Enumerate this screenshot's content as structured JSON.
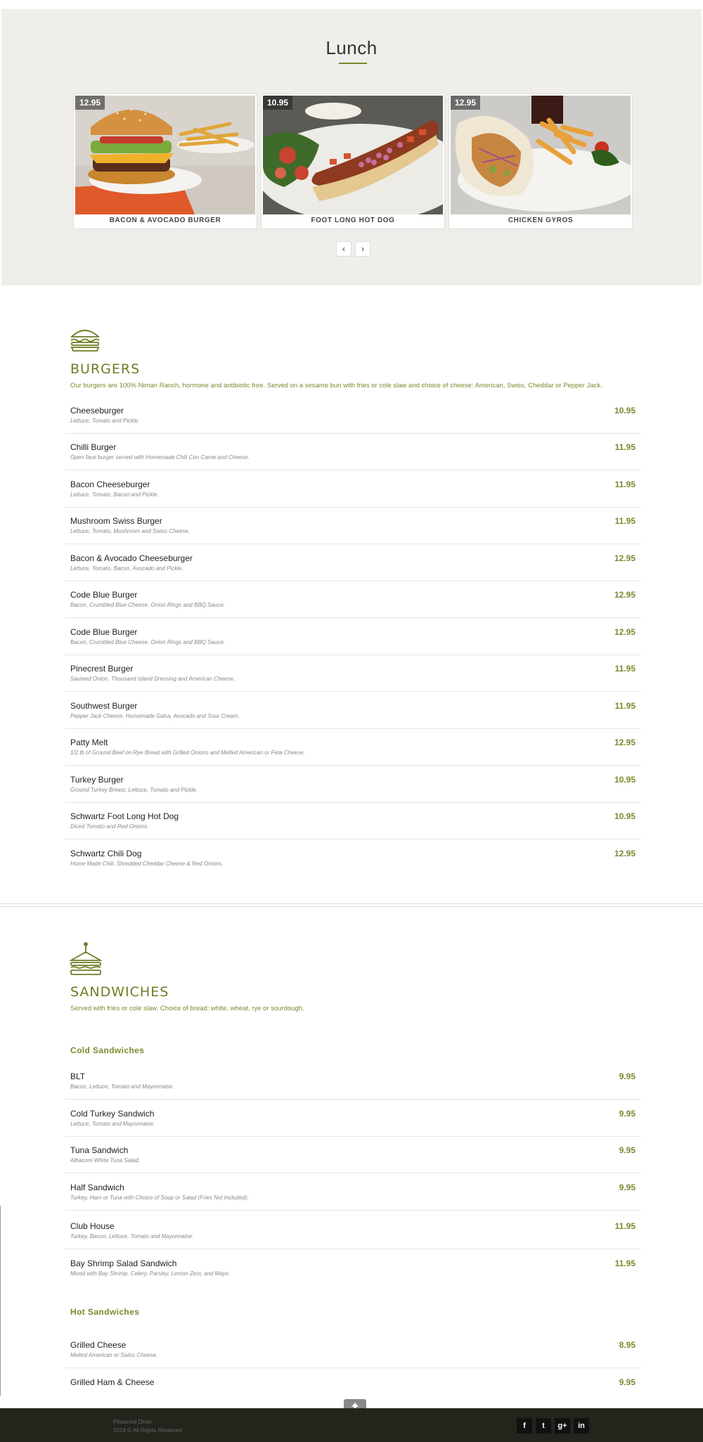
{
  "lunch": {
    "title": "Lunch",
    "cards": [
      {
        "price": "12.95",
        "name": "BACON & AVOCADO BURGER"
      },
      {
        "price": "10.95",
        "name": "FOOT LONG HOT DOG"
      },
      {
        "price": "12.95",
        "name": "CHICKEN GYROS"
      }
    ],
    "prev_icon": "‹",
    "next_icon": "›"
  },
  "burgers": {
    "title": "BURGERS",
    "description": "Our burgers are 100% Niman Ranch, hormone and antibiotic free. Served on a sesame bun with fries or cole slaw and choice of cheese: American, Swiss, Cheddar or Pepper Jack.",
    "items": [
      {
        "name": "Cheeseburger",
        "desc": "Lettuce, Tomato and Pickle.",
        "price": "10.95"
      },
      {
        "name": "Chilli Burger",
        "desc": "Open face burger served with Homemade Chili Con Carne and Cheese.",
        "price": "11.95"
      },
      {
        "name": "Bacon Cheeseburger",
        "desc": "Lettuce, Tomato, Bacon and Pickle.",
        "price": "11.95"
      },
      {
        "name": "Mushroom Swiss Burger",
        "desc": "Lettuce, Tomato, Mushroom and Swiss Cheese.",
        "price": "11.95"
      },
      {
        "name": "Bacon & Avocado Cheeseburger",
        "desc": "Lettuce, Tomato, Bacon, Avocado and Pickle.",
        "price": "12.95"
      },
      {
        "name": "Code Blue Burger",
        "desc": "Bacon, Crumbled Blue Cheese, Onion Rings and BBQ Sauce.",
        "price": "12.95"
      },
      {
        "name": "Code Blue Burger",
        "desc": "Bacon, Crumbled Blue Cheese, Onion Rings and BBQ Sauce.",
        "price": "12.95"
      },
      {
        "name": "Pinecrest Burger",
        "desc": "Sauteed Onion, Thousand Island Dressing and American Cheese.",
        "price": "11.95"
      },
      {
        "name": "Southwest Burger",
        "desc": "Pepper Jack Cheese, Homemade Salsa, Avocado and Sour Cream.",
        "price": "11.95"
      },
      {
        "name": "Patty Melt",
        "desc": "1/2 lb of Ground Beef on Rye Bread with Grilled Onions and Melted American or Feta Cheese.",
        "price": "12.95"
      },
      {
        "name": "Turkey Burger",
        "desc": "Ground Turkey Breast, Lettuce, Tomato and Pickle.",
        "price": "10.95"
      },
      {
        "name": "Schwartz Foot Long Hot Dog",
        "desc": "Diced Tomato and Red Onions.",
        "price": "10.95"
      },
      {
        "name": "Schwartz Chili Dog",
        "desc": "Home Made Chili, Shredded Cheddar Cheese & Red Onions.",
        "price": "12.95"
      }
    ]
  },
  "sandwiches": {
    "title": "SANDWICHES",
    "description": "Served with fries or cole slaw. Choice of bread: white, wheat, rye or sourdough.",
    "cold_title": "Cold Sandwiches",
    "cold": [
      {
        "name": "BLT",
        "desc": "Bacon, Lettuce, Tomato and Mayonnaise.",
        "price": "9.95"
      },
      {
        "name": "Cold Turkey Sandwich",
        "desc": "Lettuce, Tomato and Mayonnaise.",
        "price": "9.95"
      },
      {
        "name": "Tuna Sandwich",
        "desc": "Albacore White Tuna Salad.",
        "price": "9.95"
      },
      {
        "name": "Half Sandwich",
        "desc": "Turkey, Ham or Tuna with Choice of Soup or Salad (Fries Not Included).",
        "price": "9.95"
      },
      {
        "name": "Club House",
        "desc": "Turkey, Bacon, Lettuce, Tomato and Mayonnaise.",
        "price": "11.95"
      },
      {
        "name": "Bay Shrimp Salad Sandwich",
        "desc": "Mixed with Bay Shrimp, Celery, Parsley, Lemon Zest, and Mayo.",
        "price": "11.95"
      }
    ],
    "hot_title": "Hot Sandwiches",
    "hot": [
      {
        "name": "Grilled Cheese",
        "desc": "Melted American or Swiss Cheese.",
        "price": "8.95"
      },
      {
        "name": "Grilled Ham & Cheese",
        "desc": "",
        "price": "9.95"
      }
    ]
  },
  "footer": {
    "name": "Pinecrest Diner",
    "copyright": "2014 © All Rights Reserved.",
    "social": [
      {
        "icon": "facebook-icon",
        "glyph": "f"
      },
      {
        "icon": "twitter-icon",
        "glyph": "t"
      },
      {
        "icon": "google-plus-icon",
        "glyph": "g+"
      },
      {
        "icon": "linkedin-icon",
        "glyph": "in"
      }
    ],
    "scroll_top_glyph": "🡑"
  },
  "colors": {
    "accent": "#7a8a2e",
    "lunch_bg": "#efeeea",
    "footer_bg": "#24231c"
  }
}
